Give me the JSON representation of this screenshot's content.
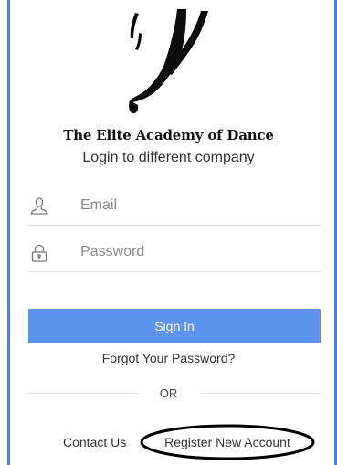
{
  "brand": {
    "name": "The Elite Academy of Dance",
    "logo": "dancer-silhouette-logo"
  },
  "login": {
    "subtitle": "Login to different company",
    "email_placeholder": "Email",
    "password_placeholder": "Password",
    "email_icon": "person-icon",
    "password_icon": "lock-icon",
    "signin_label": "Sign In",
    "forgot_label": "Forgot Your Password?",
    "divider_label": "OR",
    "contact_label": "Contact Us",
    "register_label": "Register New Account"
  },
  "colors": {
    "accent": "#5b93ee",
    "frame": "#4a7fe0"
  }
}
